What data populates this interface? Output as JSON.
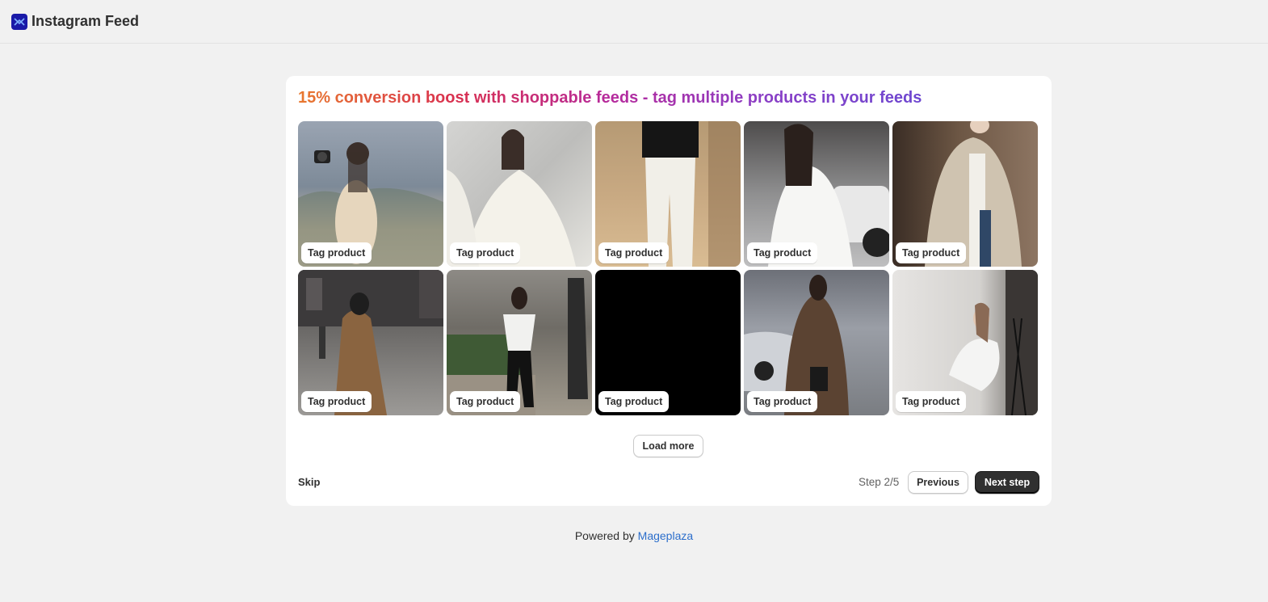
{
  "app": {
    "title": "Instagram Feed"
  },
  "onboarding": {
    "headline": "15% conversion boost with shoppable feeds - tag multiple products in your feeds",
    "tag_label": "Tag product",
    "load_more_label": "Load more",
    "skip_label": "Skip",
    "step_text": "Step 2/5",
    "previous_label": "Previous",
    "next_label": "Next step"
  },
  "feed": [
    {
      "name": "feed-photo-camera-dress"
    },
    {
      "name": "feed-photo-white-slip"
    },
    {
      "name": "feed-photo-white-trousers"
    },
    {
      "name": "feed-photo-white-shirt"
    },
    {
      "name": "feed-photo-beige-coat"
    },
    {
      "name": "feed-photo-trench-street"
    },
    {
      "name": "feed-photo-black-pants-walk"
    },
    {
      "name": "feed-photo-black"
    },
    {
      "name": "feed-photo-leopard-jacket"
    },
    {
      "name": "feed-photo-white-ruffle-dress"
    }
  ],
  "footer": {
    "prefix": "Powered by",
    "link": "Mageplaza"
  },
  "colors": {
    "primary_button": "#303030",
    "link": "#2c6ecb",
    "headline_gradient": [
      "#e8782e",
      "#d9304f",
      "#b62a9c",
      "#8a3fc6",
      "#6d47d0"
    ]
  }
}
